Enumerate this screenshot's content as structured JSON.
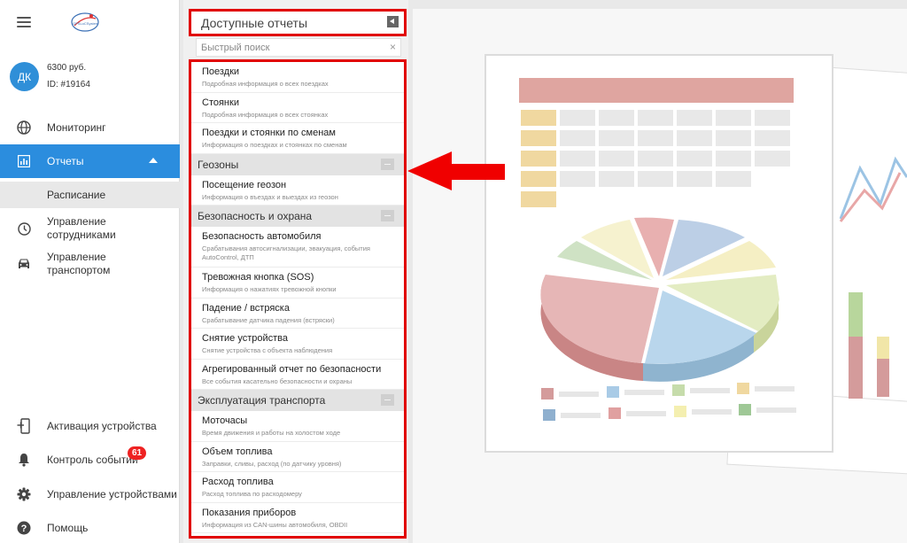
{
  "sidebar": {
    "logo_text": "GPSLoCSystem",
    "user": {
      "initials": "ДК",
      "balance": "6300 руб.",
      "id": "ID: #19164"
    },
    "nav": {
      "monitoring": "Мониторинг",
      "reports": "Отчеты",
      "schedule": "Расписание",
      "staff": "Управление сотрудниками",
      "transport": "Управление транспортом",
      "activation": "Активация устройства",
      "events": "Контроль событий",
      "events_badge": "61",
      "devices": "Управление устройствами",
      "help": "Помощь"
    },
    "icons": {
      "menu": "menu-icon",
      "monitoring": "globe-icon",
      "reports": "bar-chart-icon",
      "staff": "clock-icon",
      "transport": "car-icon",
      "activation": "add-device-icon",
      "events": "bell-icon",
      "devices": "gear-icon",
      "help": "help-icon"
    },
    "accent_color": "#2b8dde"
  },
  "reports_panel": {
    "title": "Доступные отчеты",
    "search_placeholder": "Быстрый поиск",
    "search_clear": "×",
    "items": {
      "trips": {
        "title": "Поездки",
        "desc": "Подробная информация о всех поездках"
      },
      "stops": {
        "title": "Стоянки",
        "desc": "Подробная информация о всех стоянках"
      },
      "shifts": {
        "title": "Поездки и стоянки по сменам",
        "desc": "Информация о поездках и стоянках по сменам"
      }
    },
    "groups": {
      "geozones": {
        "title": "Геозоны",
        "items": {
          "visits": {
            "title": "Посещение геозон",
            "desc": "Информация о въездах и выездах из геозон"
          }
        }
      },
      "security": {
        "title": "Безопасность и охрана",
        "items": {
          "car_security": {
            "title": "Безопасность автомобиля",
            "desc": "Срабатывания автосигнализации, эвакуация, события AutoControl, ДТП"
          },
          "sos": {
            "title": "Тревожная кнопка (SOS)",
            "desc": "Информация о нажатиях тревожной кнопки"
          },
          "fall": {
            "title": "Падение / встряска",
            "desc": "Срабатывание датчика падения (встряски)"
          },
          "removal": {
            "title": "Снятие устройства",
            "desc": "Снятие устройства с объекта наблюдения"
          },
          "aggregated": {
            "title": "Агрегированный отчет по безопасности",
            "desc": "Все события касательно безопасности и охраны"
          }
        }
      },
      "operation": {
        "title": "Эксплуатация транспорта",
        "items": {
          "engine_hours": {
            "title": "Моточасы",
            "desc": "Время движения и работы на холостом ходе"
          },
          "fuel_volume": {
            "title": "Объем топлива",
            "desc": "Заправки, сливы, расход (по датчику уровня)"
          },
          "fuel_consumption": {
            "title": "Расход топлива",
            "desc": "Расход топлива по расходомеру"
          },
          "instruments": {
            "title": "Показания приборов",
            "desc": "Информация из CAN-шины автомобиля, OBDII"
          }
        }
      }
    },
    "highlight_color": "#e10000"
  }
}
